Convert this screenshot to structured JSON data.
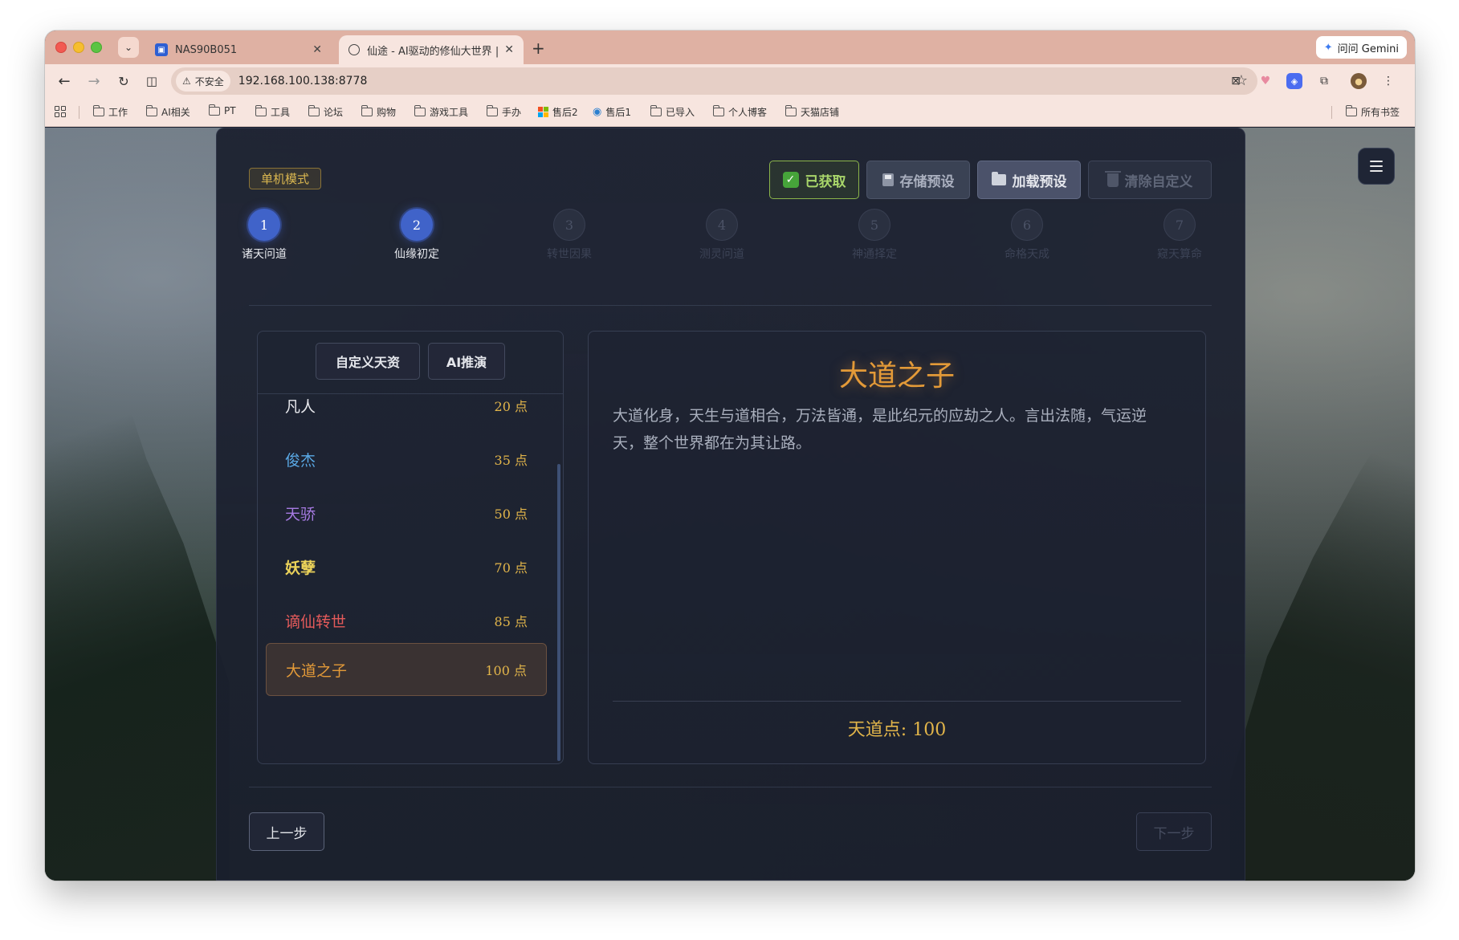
{
  "browser": {
    "tabs": [
      {
        "title": "NAS90B051",
        "favicon": "nas-icon"
      },
      {
        "title": "仙途 - AI驱动的修仙大世界 | AI",
        "favicon": "globe-icon"
      }
    ],
    "gemini_label": "问问 Gemini",
    "security_label": "不安全",
    "url": "192.168.100.138:8778",
    "bookmarks": [
      "工作",
      "AI相关",
      "PT",
      "工具",
      "论坛",
      "购物",
      "游戏工具",
      "手办",
      "售后2",
      "售后1",
      "已导入",
      "个人博客",
      "天猫店铺"
    ],
    "all_bookmarks": "所有书签"
  },
  "app": {
    "mode_badge": "单机模式",
    "buttons": {
      "acquired": "已获取",
      "save_preset": "存储预设",
      "load_preset": "加载预设",
      "clear_custom": "清除自定义"
    },
    "steps": [
      {
        "num": "1",
        "label": "诸天问道",
        "state": "active"
      },
      {
        "num": "2",
        "label": "仙缘初定",
        "state": "active"
      },
      {
        "num": "3",
        "label": "转世因果",
        "state": "inactive"
      },
      {
        "num": "4",
        "label": "测灵问道",
        "state": "inactive"
      },
      {
        "num": "5",
        "label": "神通择定",
        "state": "inactive"
      },
      {
        "num": "6",
        "label": "命格天成",
        "state": "inactive"
      },
      {
        "num": "7",
        "label": "窥天算命",
        "state": "inactive"
      }
    ],
    "list_tabs": {
      "custom": "自定义天资",
      "ai": "AI推演"
    },
    "talents": [
      {
        "name": "凡人",
        "cost": "20 点",
        "color": "#e9eaee"
      },
      {
        "name": "俊杰",
        "cost": "35 点",
        "color": "#5aa9e6"
      },
      {
        "name": "天骄",
        "cost": "50 点",
        "color": "#a77be3"
      },
      {
        "name": "妖孽",
        "cost": "70 点",
        "color": "#ecd35a"
      },
      {
        "name": "谪仙转世",
        "cost": "85 点",
        "color": "#e35a5a"
      },
      {
        "name": "大道之子",
        "cost": "100 点",
        "color": "#e39a38"
      }
    ],
    "selected_index": 5,
    "detail": {
      "title": "大道之子",
      "description": "大道化身，天生与道相合，万法皆通，是此纪元的应劫之人。言出法随，气运逆天，整个世界都在为其让路。",
      "points": "天道点: 100"
    },
    "nav": {
      "prev": "上一步",
      "next": "下一步"
    }
  }
}
